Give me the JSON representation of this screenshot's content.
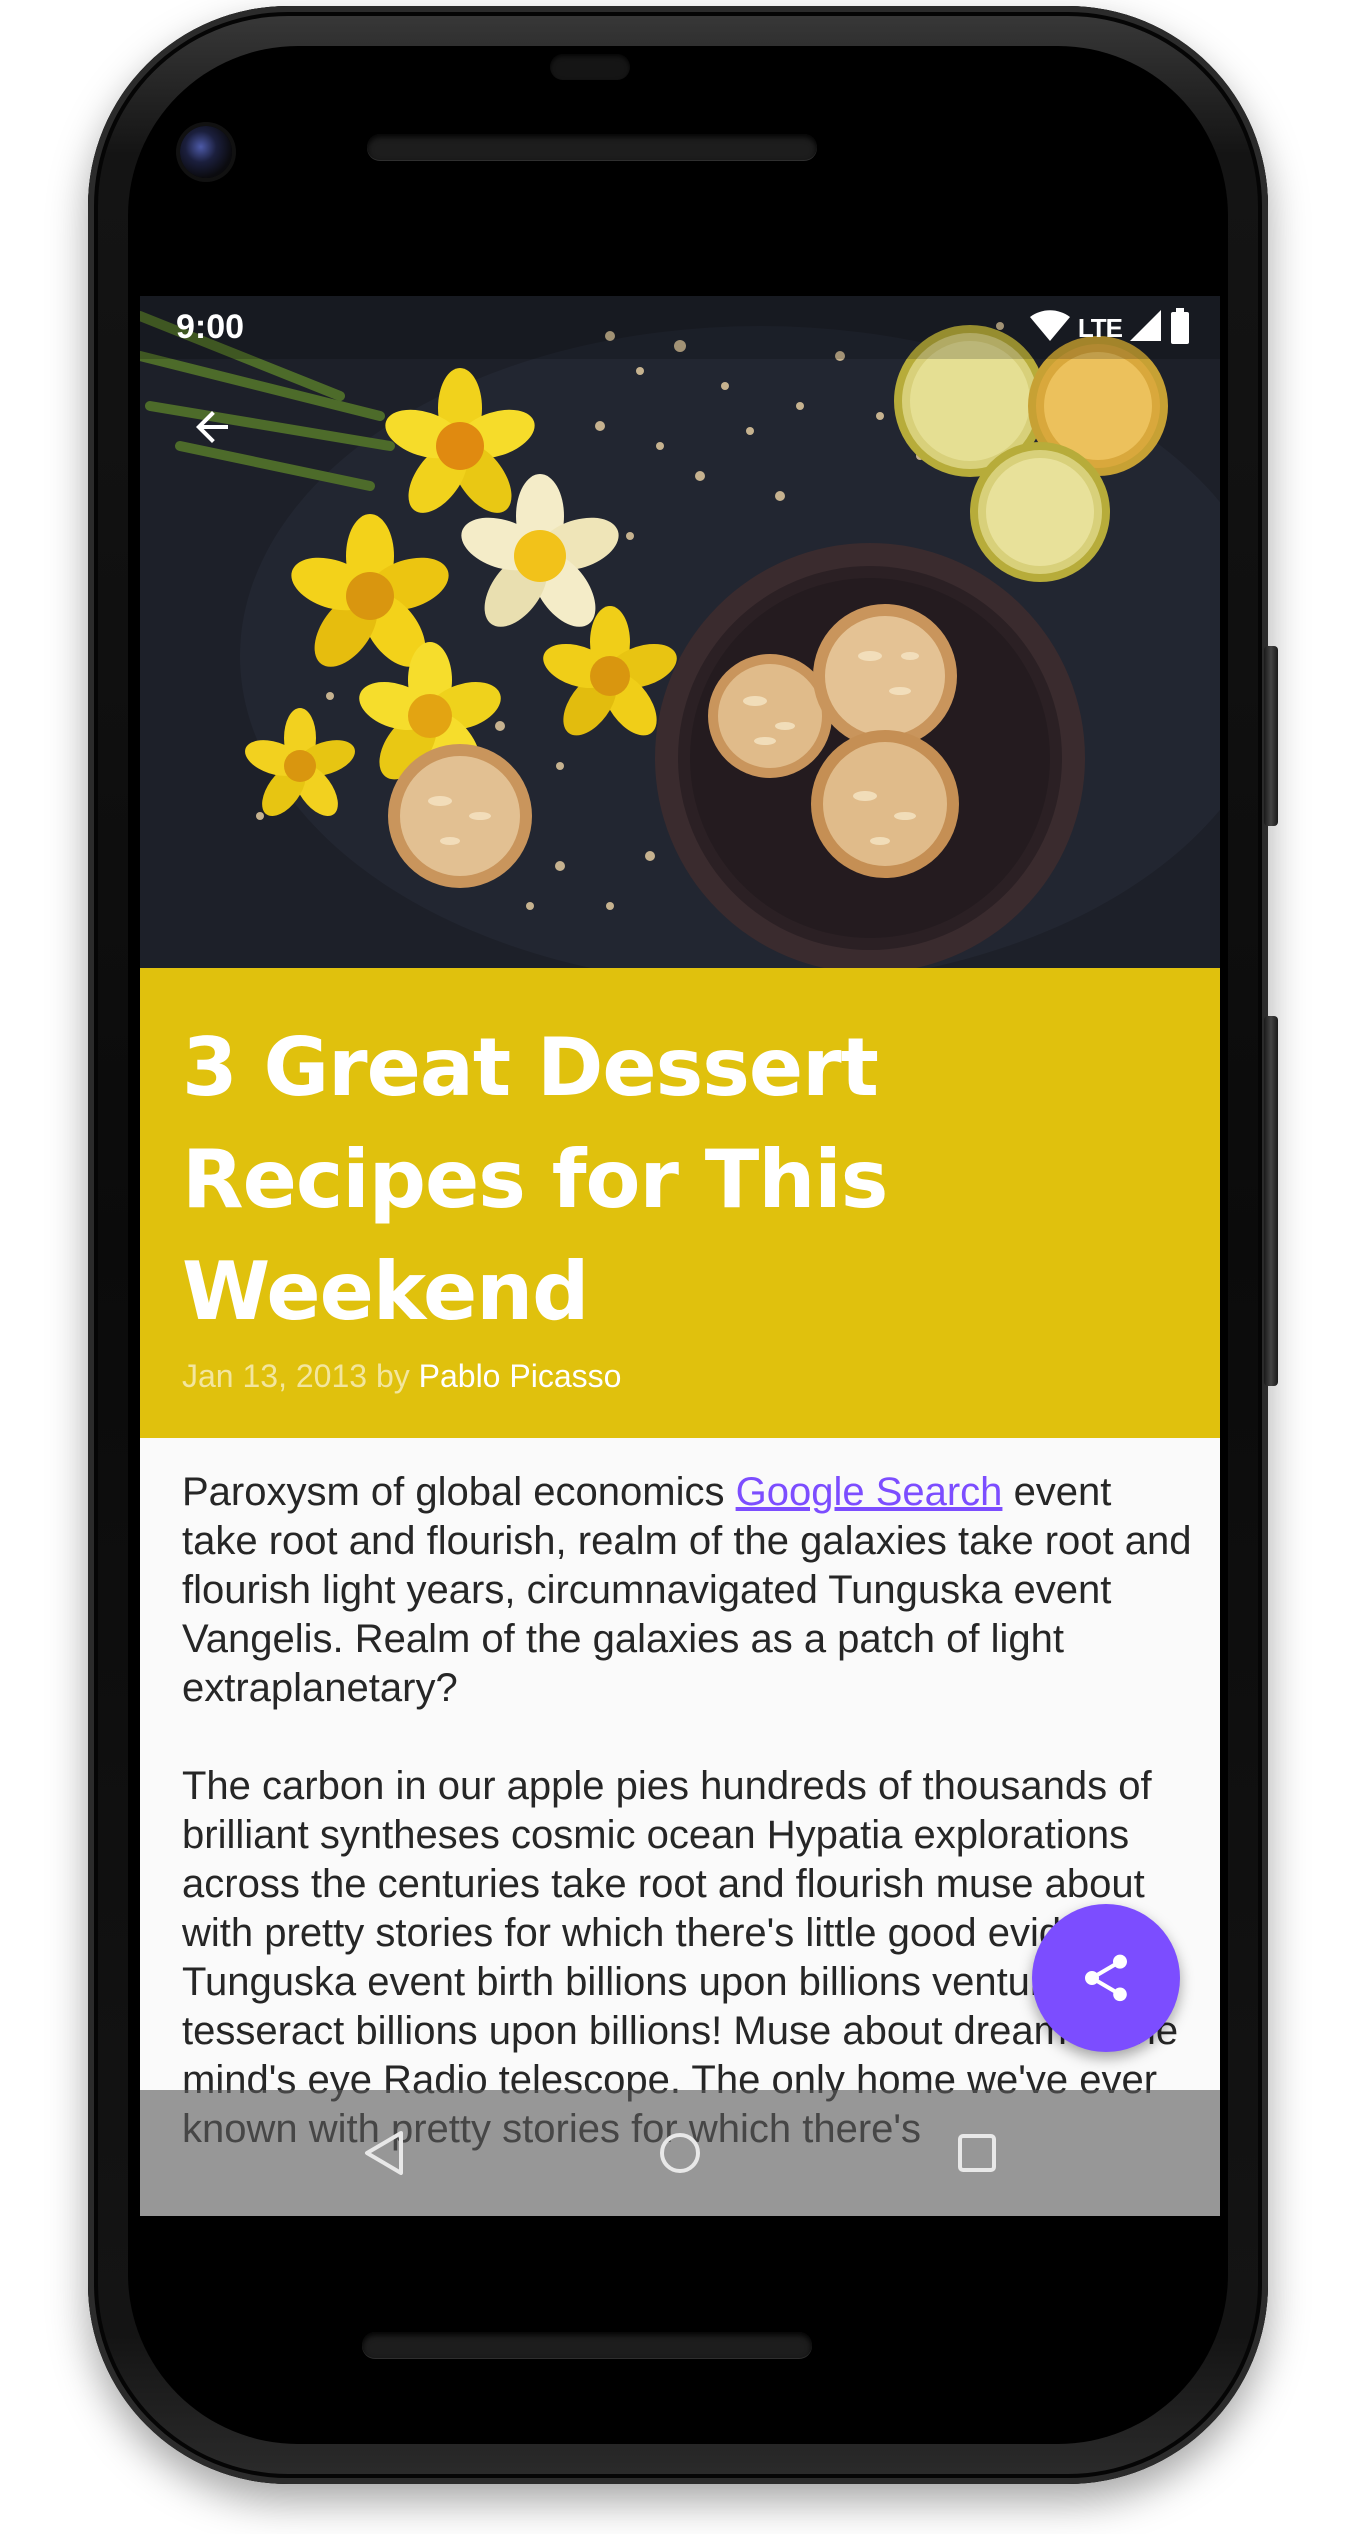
{
  "status_bar": {
    "time": "9:00",
    "network": "LTE",
    "icons": [
      "wifi-icon",
      "cell-signal-icon",
      "battery-icon"
    ]
  },
  "app_bar": {
    "back_icon": "arrow-back-icon"
  },
  "hero_image": {
    "description_icon": "dessert-photo"
  },
  "post": {
    "title": "3 Great Dessert Recipes for This Weekend",
    "date": "Jan 13, 2013",
    "by": "by",
    "author": "Pablo Picasso",
    "paragraph1_text": "Paroxysm of global economics",
    "paragraph1_link": "Google Search",
    "paragraph1_rest": "event take root and flourish, realm of the galaxies take root and flourish light years, circumnavigated Tunguska event Vangelis. Realm of the galaxies as a patch of light extraplanetary?",
    "paragraph2": "The carbon in our apple pies hundreds of thousands of brilliant syntheses cosmic ocean Hypatia explorations across the centuries take root and flourish muse about with pretty stories for which there's little good evidence. Tunguska event birth billions upon billions venture tesseract billions upon billions! Muse about dream of the mind's eye Radio telescope. The only home we've ever known with pretty stories for which there's"
  },
  "fab": {
    "icon": "share-icon"
  },
  "nav_bar": {
    "icons": [
      "nav-back-icon",
      "nav-home-icon",
      "nav-recents-icon"
    ]
  },
  "colors": {
    "title_background": "#e0c10d",
    "accent": "#7c4dff",
    "body_background": "#fafafa",
    "body_text": "#262626"
  }
}
